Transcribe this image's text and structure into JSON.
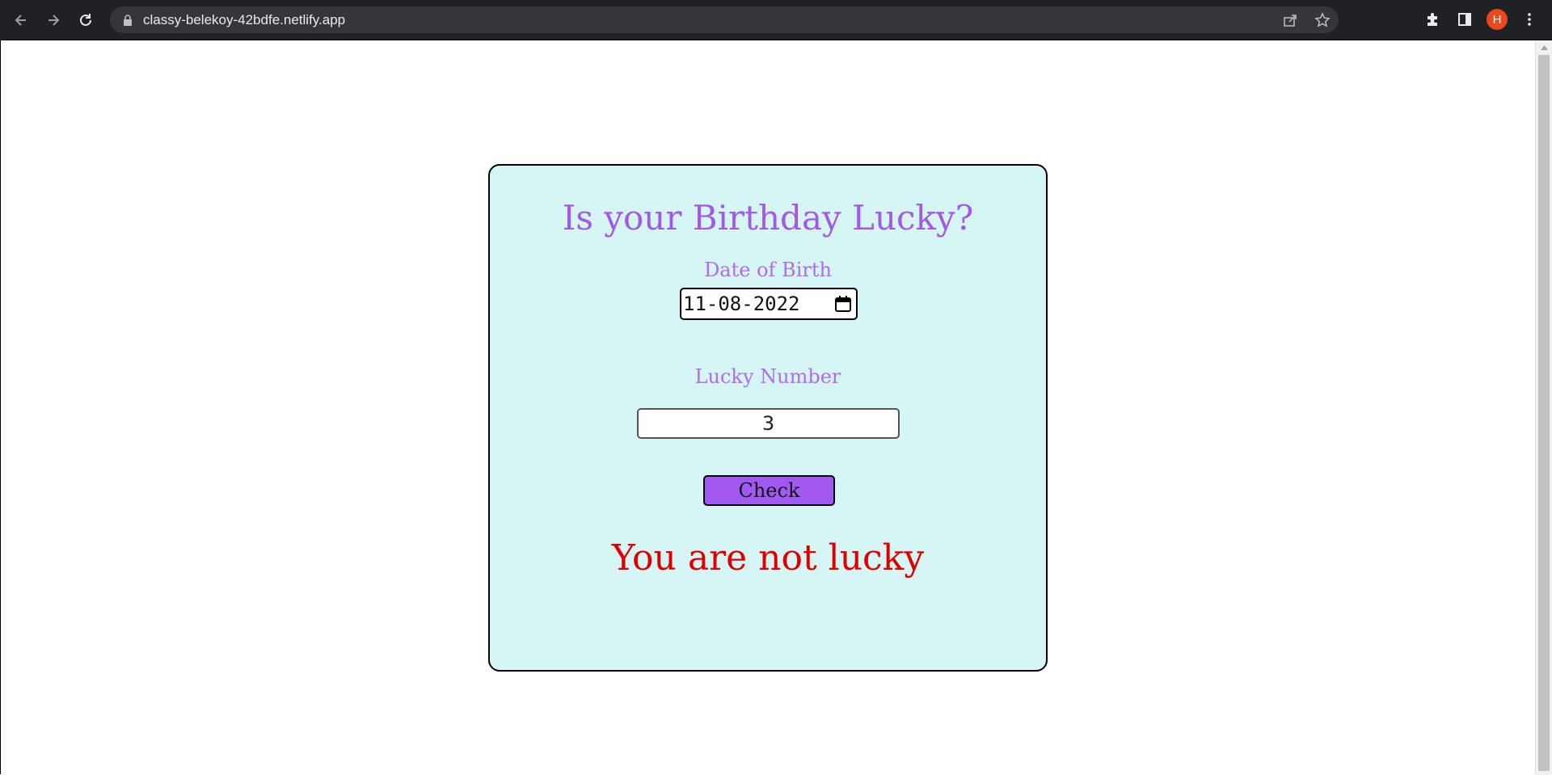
{
  "browser": {
    "url": "classy-belekoy-42bdfe.netlify.app",
    "profile_initial": "H"
  },
  "app": {
    "title": "Is your Birthday Lucky?",
    "dob_label": "Date of Birth",
    "dob_value": "11-08-2022",
    "lucky_label": "Lucky Number",
    "lucky_value": "3",
    "check_label": "Check",
    "result": "You are not lucky"
  }
}
